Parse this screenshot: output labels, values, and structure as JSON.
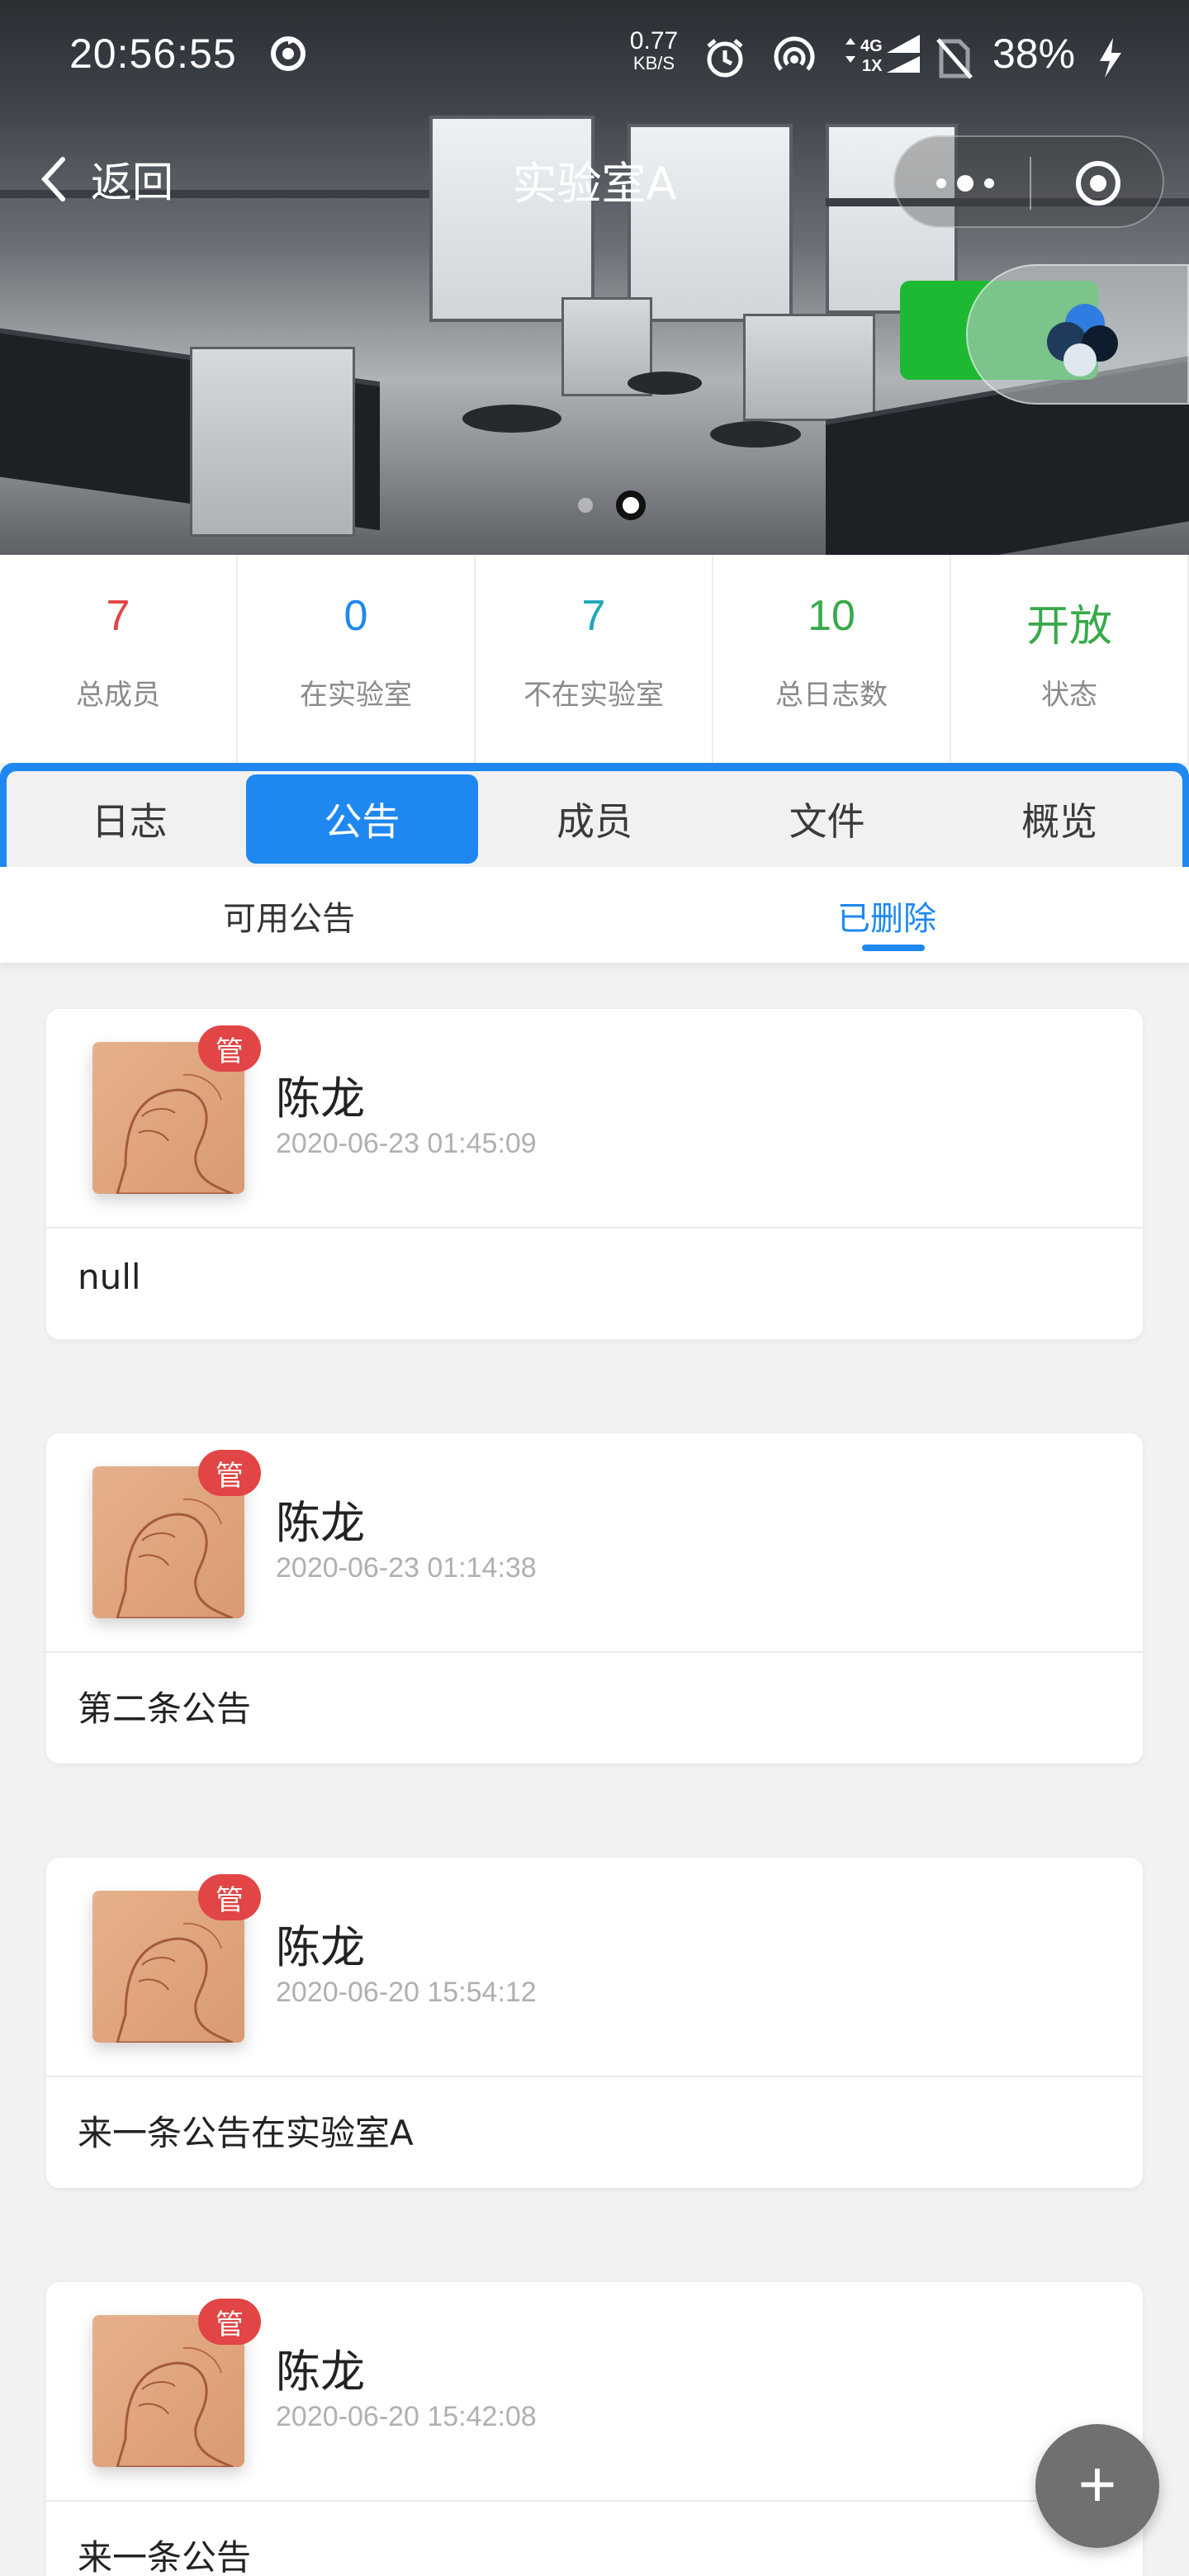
{
  "status_bar": {
    "time": "20:56:55",
    "net_speed_value": "0.77",
    "net_speed_unit": "KB/S",
    "network_top": "4G",
    "network_bottom": "1X",
    "battery": "38%"
  },
  "nav": {
    "back_label": "返回",
    "title": "实验室A"
  },
  "banner": {
    "pager_count": 2,
    "pager_active_index": 1
  },
  "stats": [
    {
      "value": "7",
      "label": "总成员",
      "color": "#e24545"
    },
    {
      "value": "0",
      "label": "在实验室",
      "color": "#1e88f0"
    },
    {
      "value": "7",
      "label": "不在实验室",
      "color": "#1fa8b8"
    },
    {
      "value": "10",
      "label": "总日志数",
      "color": "#39a94a"
    },
    {
      "value": "开放",
      "label": "状态",
      "color": "#39a94a"
    }
  ],
  "tabs": [
    {
      "label": "日志",
      "active": false
    },
    {
      "label": "公告",
      "active": true
    },
    {
      "label": "成员",
      "active": false
    },
    {
      "label": "文件",
      "active": false
    },
    {
      "label": "概览",
      "active": false
    }
  ],
  "subtabs": {
    "available": "可用公告",
    "deleted": "已删除",
    "active": "deleted"
  },
  "announcements": [
    {
      "badge": "管",
      "name": "陈龙",
      "date": "2020-06-23 01:45:09",
      "content": "null"
    },
    {
      "badge": "管",
      "name": "陈龙",
      "date": "2020-06-23 01:14:38",
      "content": "第二条公告"
    },
    {
      "badge": "管",
      "name": "陈龙",
      "date": "2020-06-20 15:54:12",
      "content": "来一条公告在实验室A"
    },
    {
      "badge": "管",
      "name": "陈龙",
      "date": "2020-06-20 15:42:08",
      "content": "来一条公告"
    }
  ],
  "fab": {
    "label": "+"
  },
  "colors": {
    "accent": "#1e88f0",
    "badge": "#e24545",
    "green": "#1eb933"
  }
}
